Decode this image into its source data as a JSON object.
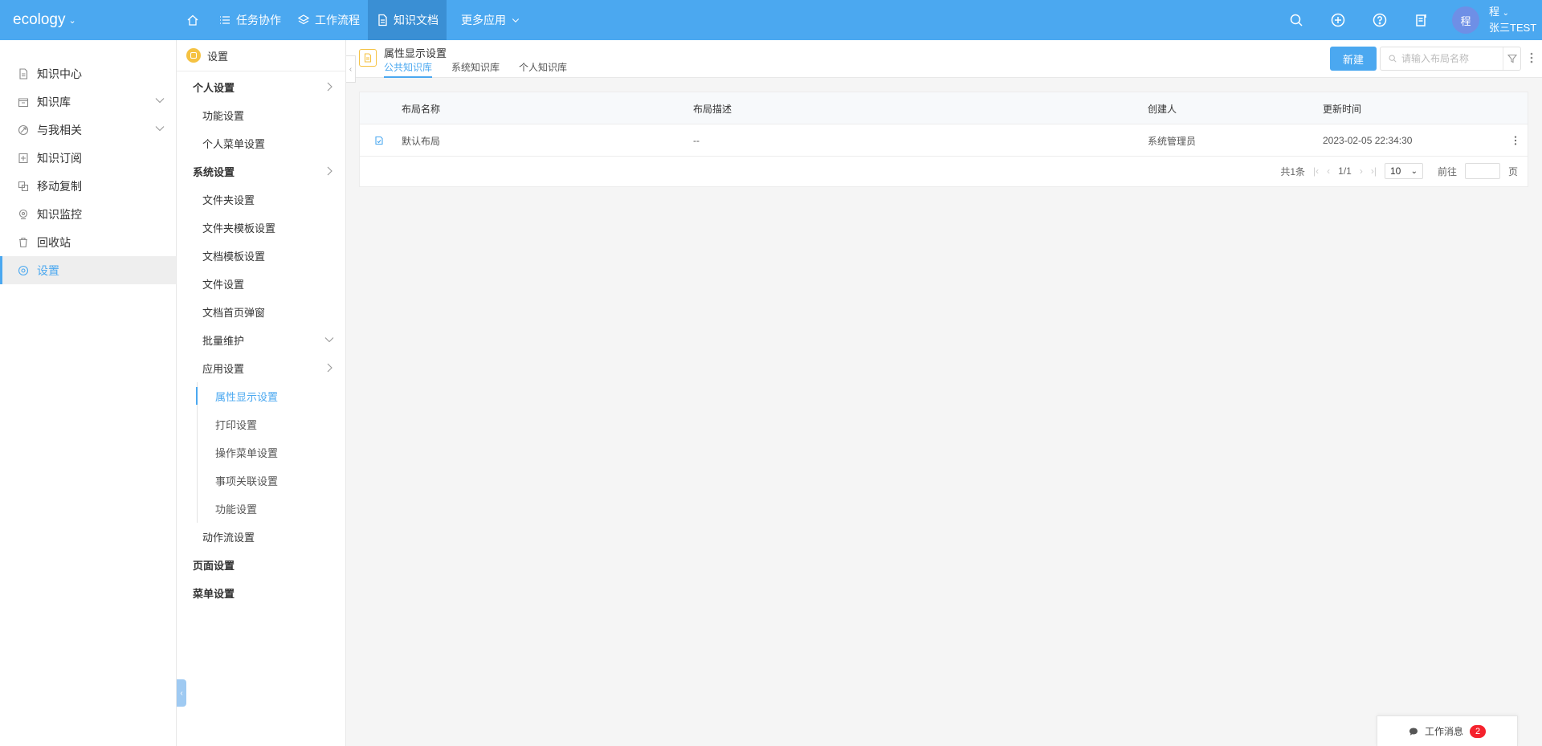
{
  "topbar": {
    "logo": "ecology",
    "nav": [
      {
        "label": "任务协作"
      },
      {
        "label": "工作流程"
      },
      {
        "label": "知识文档"
      },
      {
        "label": "更多应用"
      }
    ],
    "avatar_text": "程",
    "user_name": "程",
    "user_sub": "张三TEST"
  },
  "leftnav": {
    "items": [
      {
        "label": "知识中心",
        "icon": "document-icon"
      },
      {
        "label": "知识库",
        "icon": "library-icon"
      },
      {
        "label": "与我相关",
        "icon": "related-icon"
      },
      {
        "label": "知识订阅",
        "icon": "subscribe-icon"
      },
      {
        "label": "移动复制",
        "icon": "copy-icon"
      },
      {
        "label": "知识监控",
        "icon": "monitor-icon"
      },
      {
        "label": "回收站",
        "icon": "trash-icon"
      },
      {
        "label": "设置",
        "icon": "gear-icon"
      }
    ]
  },
  "tree": {
    "title": "设置",
    "items": {
      "personal": "个人设置",
      "func": "功能设置",
      "personal_menu": "个人菜单设置",
      "system": "系统设置",
      "folder": "文件夹设置",
      "folder_tpl": "文件夹模板设置",
      "doc_tpl": "文档模板设置",
      "file": "文件设置",
      "home_popup": "文档首页弹窗",
      "batch": "批量维护",
      "app": "应用设置",
      "attr": "属性显示设置",
      "print": "打印设置",
      "op_menu": "操作菜单设置",
      "relation": "事项关联设置",
      "app_func": "功能设置",
      "action_flow": "动作流设置",
      "page": "页面设置",
      "menu": "菜单设置"
    }
  },
  "main": {
    "title": "属性显示设置",
    "tabs": [
      "公共知识库",
      "系统知识库",
      "个人知识库"
    ],
    "new_label": "新建",
    "search_placeholder": "请输入布局名称",
    "columns": [
      "布局名称",
      "布局描述",
      "创建人",
      "更新时间"
    ],
    "rows": [
      {
        "name": "默认布局",
        "desc": "--",
        "creator": "系统管理员",
        "updated": "2023-02-05 22:34:30"
      }
    ],
    "pager": {
      "total": "共1条",
      "page": "1/1",
      "size": "10",
      "goto": "前往",
      "page_unit": "页"
    }
  },
  "message_bar": {
    "label": "工作消息",
    "count": "2"
  },
  "colors": {
    "accent": "#4ba8f0",
    "topbar": "#4ba8f0",
    "badge": "#f5222d",
    "folder_icon": "#f5c242"
  }
}
